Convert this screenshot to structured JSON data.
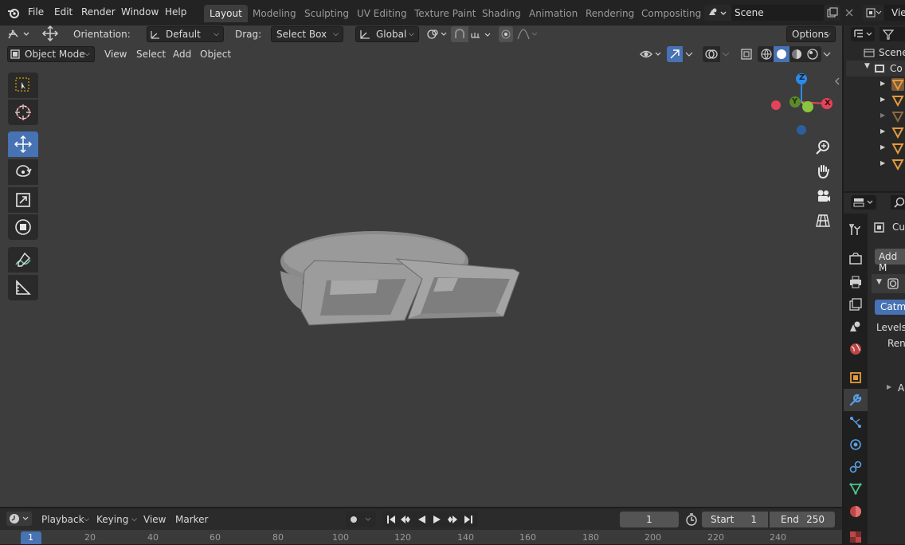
{
  "menus": [
    "File",
    "Edit",
    "Render",
    "Window",
    "Help"
  ],
  "workspaces": [
    "Layout",
    "Modeling",
    "Sculpting",
    "UV Editing",
    "Texture Paint",
    "Shading",
    "Animation",
    "Rendering",
    "Compositing"
  ],
  "scene_name": "Scene",
  "view_layer": "Vie",
  "tool_header": {
    "orientation_label": "Orientation:",
    "orientation_value": "Default",
    "drag_label": "Drag:",
    "drag_value": "Select Box",
    "transform_space": "Global",
    "options": "Options"
  },
  "viewport_header": {
    "mode": "Object Mode",
    "menus": [
      "View",
      "Select",
      "Add",
      "Object"
    ]
  },
  "gizmo": {
    "z": "Z",
    "y": "Y",
    "x": "X"
  },
  "timeline": {
    "menus": [
      "Playback",
      "Keying",
      "View",
      "Marker"
    ],
    "current_frame": "1",
    "start_label": "Start",
    "start": "1",
    "end_label": "End",
    "end": "250",
    "ticks": [
      "20",
      "40",
      "60",
      "80",
      "100",
      "120",
      "140",
      "160",
      "180",
      "200",
      "220",
      "240"
    ],
    "playhead": "1"
  },
  "outliner": {
    "scene": "Scene",
    "collection": "Co"
  },
  "properties": {
    "object_name": "Cu",
    "add_modifier": "Add M",
    "subdiv_type": "Catmu",
    "levels_label": "Levels",
    "render_label": "Rend",
    "advanced_label": "A"
  },
  "colors": {
    "viewport_bg": "#3d3d3d",
    "accent": "#4772b3",
    "axis_x": "#e3435a",
    "axis_y": "#8bc53f",
    "axis_z": "#2b8ae8"
  }
}
